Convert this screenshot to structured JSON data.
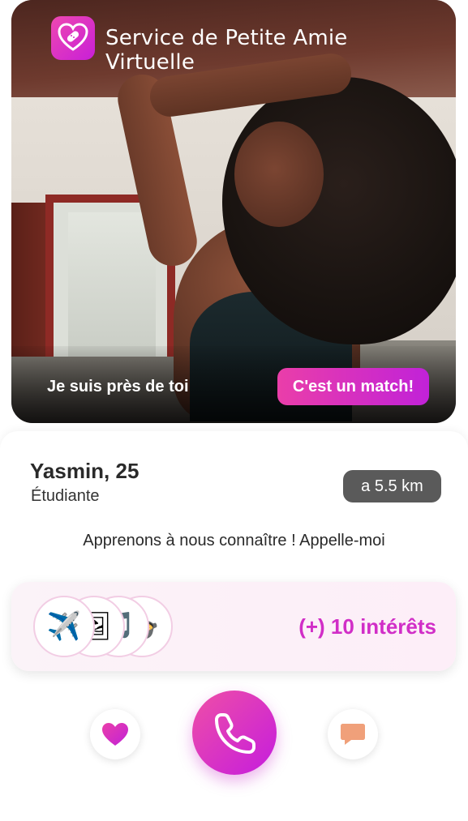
{
  "header": {
    "app_title": "Service de Petite Amie Virtuelle",
    "logo_icon": "heart-bandage-icon"
  },
  "hero": {
    "near_text": "Je suis près de toi",
    "match_button": "C'est un match!"
  },
  "profile": {
    "name_age": "Yasmin, 25",
    "occupation": "Étudiante",
    "distance": "a 5.5 km",
    "tagline": "Apprenons à nous connaître ! Appelle-moi"
  },
  "interests": {
    "icons": [
      "airplane-icon",
      "photo-icon",
      "music-note-icon",
      "food-icon"
    ],
    "glyphs": [
      "✈️",
      "🖼",
      "🎵",
      "🍲"
    ],
    "count_label": "(+) 10 intérêts"
  },
  "actions": {
    "like_icon": "heart-icon",
    "call_icon": "phone-icon",
    "chat_icon": "chat-bubble-icon"
  },
  "colors": {
    "accent_start": "#ea3ea9",
    "accent_end": "#c122d8",
    "interest_text": "#d12ec7",
    "distance_bg": "#5a5a5a",
    "chat_icon": "#f0a07a"
  }
}
